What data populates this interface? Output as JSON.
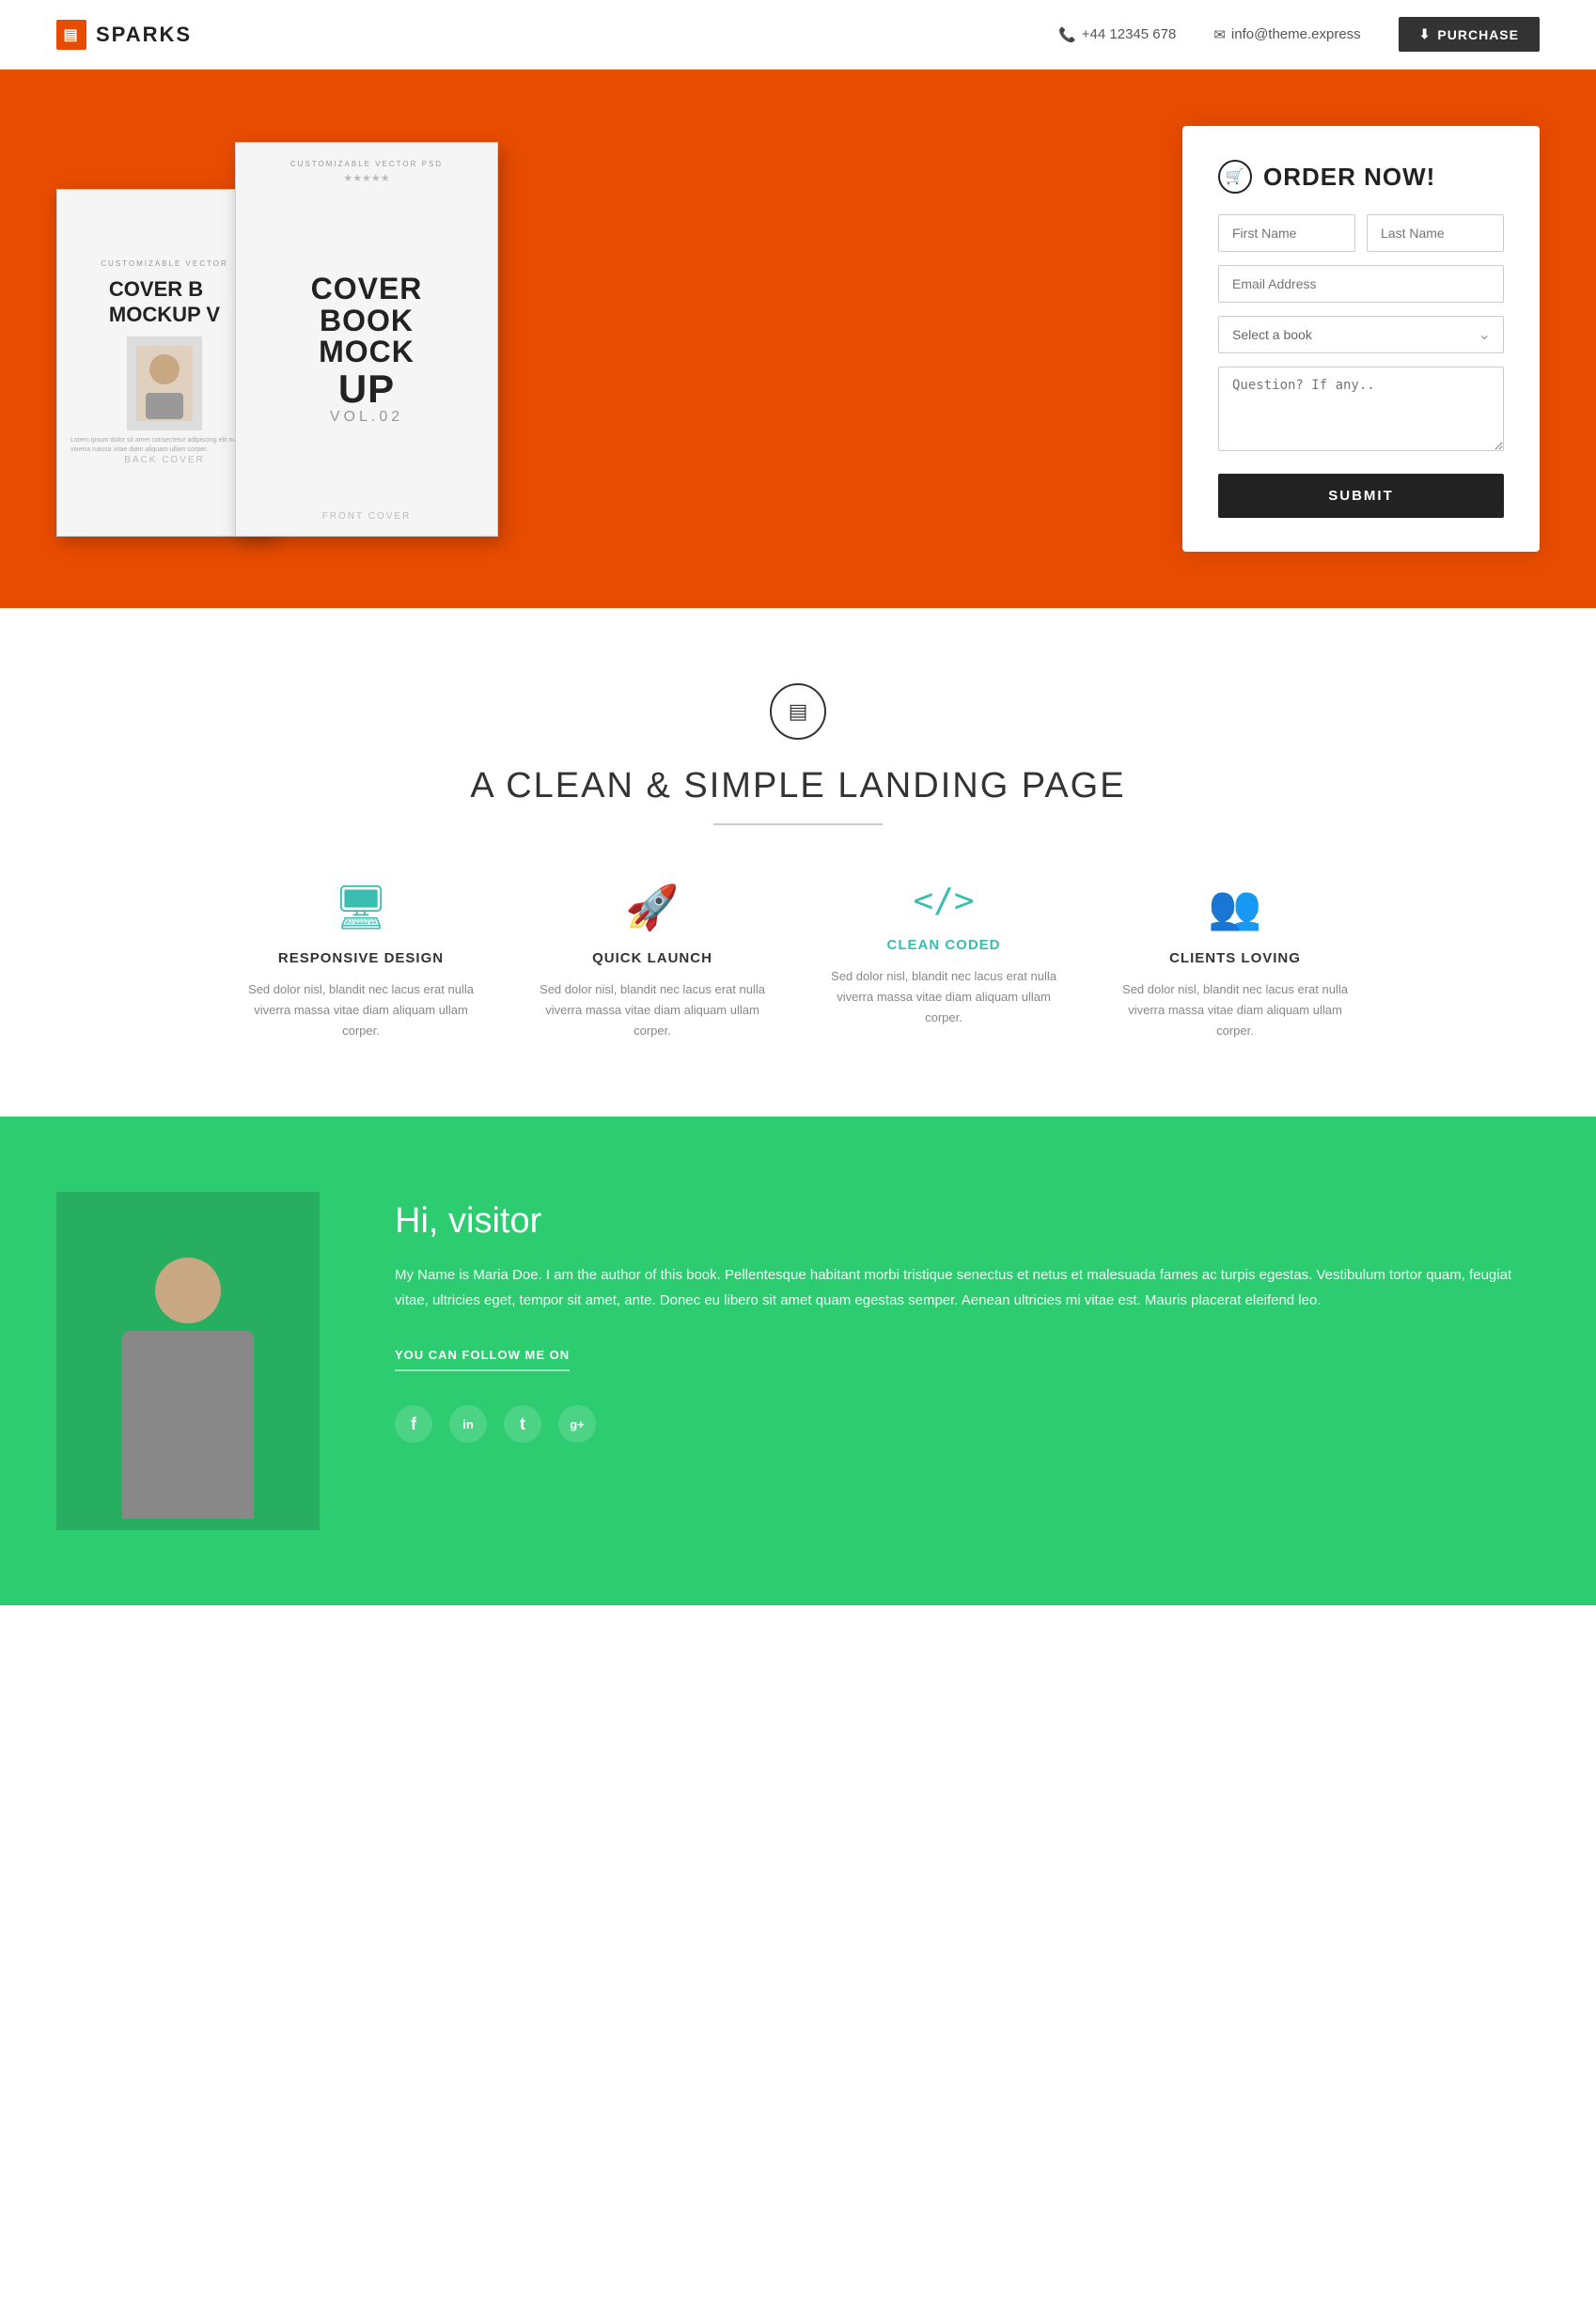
{
  "header": {
    "logo_icon": "▤",
    "logo_text": "SPARKS",
    "phone_icon": "📞",
    "phone": "+44 12345 678",
    "email_icon": "✉",
    "email": "info@theme.express",
    "purchase_icon": "⬇",
    "purchase_label": "PURCHASE"
  },
  "hero": {
    "book_back": {
      "badge": "CUSTOMIZABLE VECTOR",
      "title_line1": "COVER B",
      "title_line2": "MOCKUP V",
      "label": "BACK COVER",
      "text": "Lorem ipsum dolor sit amet consectetur adipiscing elit nulla viverra massa vitae diam aliquam ullam corper."
    },
    "book_front": {
      "badge": "CUSTOMIZABLE VECTOR PSD",
      "star": "★★★★★",
      "title_line1": "COVER",
      "title_line2": "BOOK",
      "title_line3": "MOCK",
      "title_line4": "UP",
      "vol": "VOL.02",
      "label": "FRONT COVER"
    },
    "form": {
      "title_icon": "🛒",
      "title": "ORDER NOW!",
      "first_name_placeholder": "First Name",
      "last_name_placeholder": "Last Name",
      "email_placeholder": "Email Address",
      "select_placeholder": "Select a book",
      "question_placeholder": "Question? If any..",
      "submit_label": "SUBMIT"
    }
  },
  "features": {
    "icon": "▤",
    "heading": "A CLEAN & SIMPLE LANDING PAGE",
    "items": [
      {
        "icon": "🖥",
        "icon_color": "teal",
        "title": "RESPONSIVE DESIGN",
        "title_color": "normal",
        "desc": "Sed dolor nisl, blandit nec lacus erat nulla viverra massa vitae diam aliquam ullam corper."
      },
      {
        "icon": "🚀",
        "icon_color": "orange",
        "title": "QUICK LAUNCH",
        "title_color": "normal",
        "desc": "Sed dolor nisl, blandit nec lacus erat nulla viverra massa vitae diam aliquam ullam corper."
      },
      {
        "icon": "</>",
        "icon_color": "teal",
        "title": "CLEAN CODED",
        "title_color": "teal",
        "desc": "Sed dolor nisl, blandit nec lacus erat nulla viverra massa vitae diam aliquam ullam corper."
      },
      {
        "icon": "👥",
        "icon_color": "orange",
        "title": "CLIENTS LOVING",
        "title_color": "normal",
        "desc": "Sed dolor nisl, blandit nec lacus erat nulla viverra massa vitae diam aliquam ullam corper."
      }
    ]
  },
  "author": {
    "greeting": "Hi, visitor",
    "bio": "My Name is Maria Doe. I am the author of this book. Pellentesque habitant morbi tristique senectus et netus et malesuada fames ac turpis egestas. Vestibulum tortor quam, feugiat vitae, ultricies eget, tempor sit amet, ante. Donec eu libero sit amet quam egestas semper. Aenean ultricies mi vitae est. Mauris placerat eleifend leo.",
    "follow_label": "YOU CAN FOLLOW ME ON",
    "social": [
      {
        "icon": "f",
        "name": "facebook"
      },
      {
        "icon": "in",
        "name": "linkedin"
      },
      {
        "icon": "t",
        "name": "twitter"
      },
      {
        "icon": "g+",
        "name": "google-plus"
      }
    ]
  }
}
